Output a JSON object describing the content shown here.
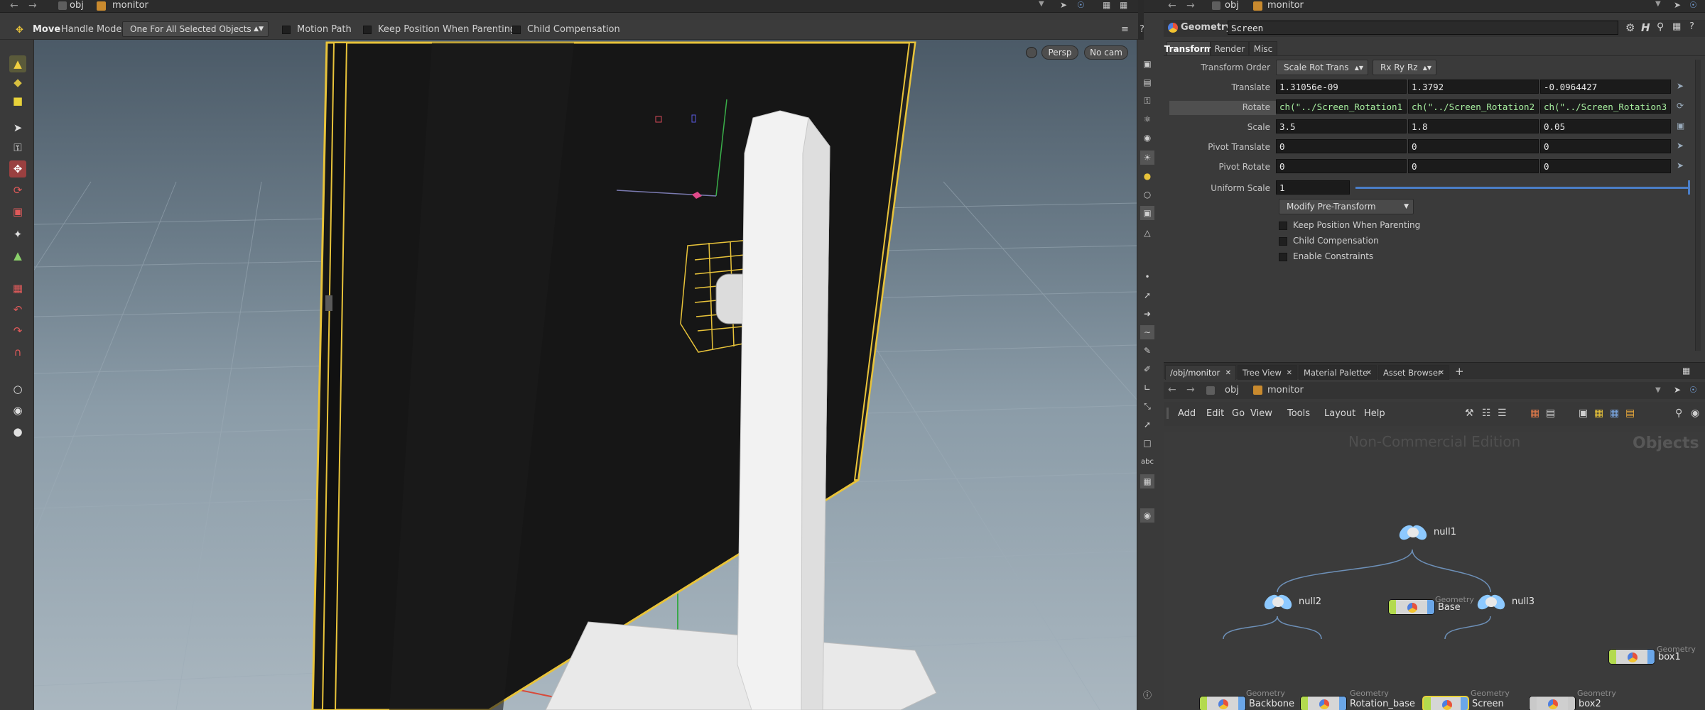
{
  "viewer_pane": {
    "path": [
      "obj",
      "monitor"
    ],
    "toolbar": {
      "tool_name": "Move",
      "handle_mode_label": "Handle Mode",
      "handle_mode_value": "One For All Selected Objects",
      "motion_path": "Motion Path",
      "keep_position": "Keep Position When Parenting",
      "child_comp": "Child Compensation"
    },
    "persp": "Persp",
    "cam": "No cam"
  },
  "param_pane": {
    "path": [
      "obj",
      "monitor"
    ],
    "node_type": "Geometry",
    "node_name": "Screen",
    "tabs": [
      "Transform",
      "Render",
      "Misc"
    ],
    "transform_order_label": "Transform Order",
    "transform_order_value": "Scale Rot Trans",
    "rot_order_value": "Rx Ry Rz",
    "translate_label": "Translate",
    "translate": [
      "1.31056e-09",
      "1.3792",
      "-0.0964427"
    ],
    "rotate_label": "Rotate",
    "rotate": [
      "ch(\"../Screen_Rotation1",
      "ch(\"../Screen_Rotation2",
      "ch(\"../Screen_Rotation3"
    ],
    "scale_label": "Scale",
    "scale": [
      "3.5",
      "1.8",
      "0.05"
    ],
    "pivot_translate_label": "Pivot Translate",
    "pivot_translate": [
      "0",
      "0",
      "0"
    ],
    "pivot_rotate_label": "Pivot Rotate",
    "pivot_rotate": [
      "0",
      "0",
      "0"
    ],
    "uniform_scale_label": "Uniform Scale",
    "uniform_scale": "1",
    "modify_pretransform": "Modify Pre-Transform",
    "checkboxes": [
      "Keep Position When Parenting",
      "Child Compensation",
      "Enable Constraints"
    ]
  },
  "network_pane": {
    "tabs": [
      "/obj/monitor",
      "Tree View",
      "Material Palette",
      "Asset Browser"
    ],
    "path": [
      "obj",
      "monitor"
    ],
    "menu": [
      "Add",
      "Edit",
      "Go",
      "View",
      "Tools",
      "Layout",
      "Help"
    ],
    "watermark": "Non-Commercial Edition",
    "context_label": "Objects",
    "geometry_type": "Geometry",
    "nodes": {
      "base": "Base",
      "null1": "null1",
      "null2": "null2",
      "null3": "null3",
      "box1": "box1",
      "backbone": "Backbone",
      "rotation_base": "Rotation_base",
      "screen": "Screen",
      "box2": "box2"
    }
  },
  "colors": {
    "geo_green": "#b3da4e",
    "geo_blue": "#6aa6e8",
    "selected_yellow": "#e8d23a",
    "expr_green": "#a8f0a0"
  }
}
